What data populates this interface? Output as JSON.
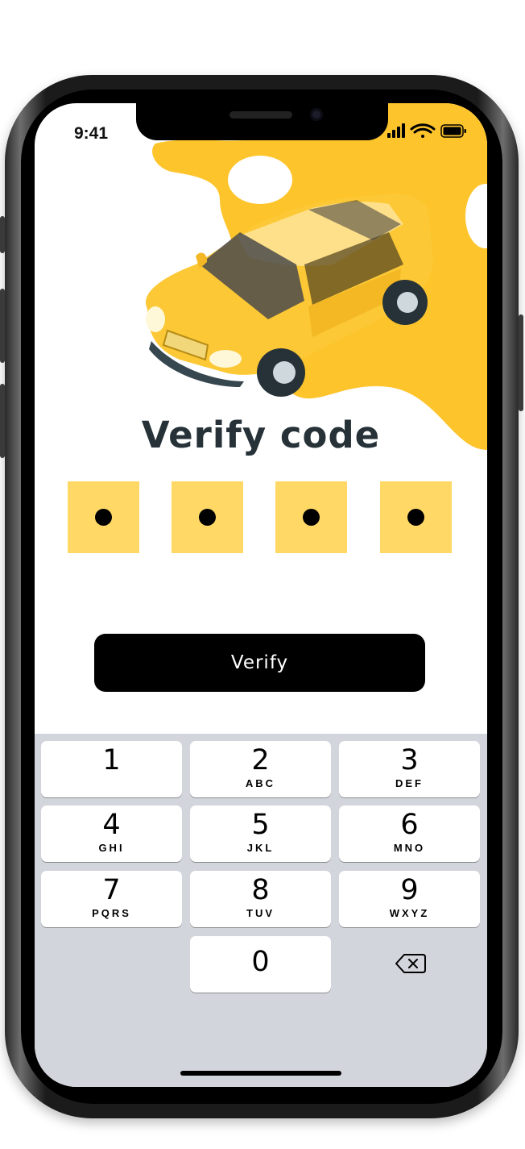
{
  "status_bar": {
    "time": "9:41",
    "signal_icon": "cellular-signal-icon",
    "wifi_icon": "wifi-icon",
    "battery_icon": "battery-icon"
  },
  "hero": {
    "illustration": "yellow-car-illustration",
    "blob_color": "#fdc42b",
    "car_color": "#fcc835"
  },
  "title": "Verify code",
  "code_boxes": {
    "count": 4,
    "filled": 4,
    "box_color": "#ffd866",
    "dot_color": "#000000"
  },
  "verify_button": {
    "label": "Verify"
  },
  "keypad": {
    "keys": [
      {
        "num": "1",
        "letters": ""
      },
      {
        "num": "2",
        "letters": "ABC"
      },
      {
        "num": "3",
        "letters": "DEF"
      },
      {
        "num": "4",
        "letters": "GHI"
      },
      {
        "num": "5",
        "letters": "JKL"
      },
      {
        "num": "6",
        "letters": "MNO"
      },
      {
        "num": "7",
        "letters": "PQRS"
      },
      {
        "num": "8",
        "letters": "TUV"
      },
      {
        "num": "9",
        "letters": "WXYZ"
      },
      {
        "num": "0",
        "letters": ""
      }
    ],
    "backspace_icon": "backspace-icon"
  }
}
